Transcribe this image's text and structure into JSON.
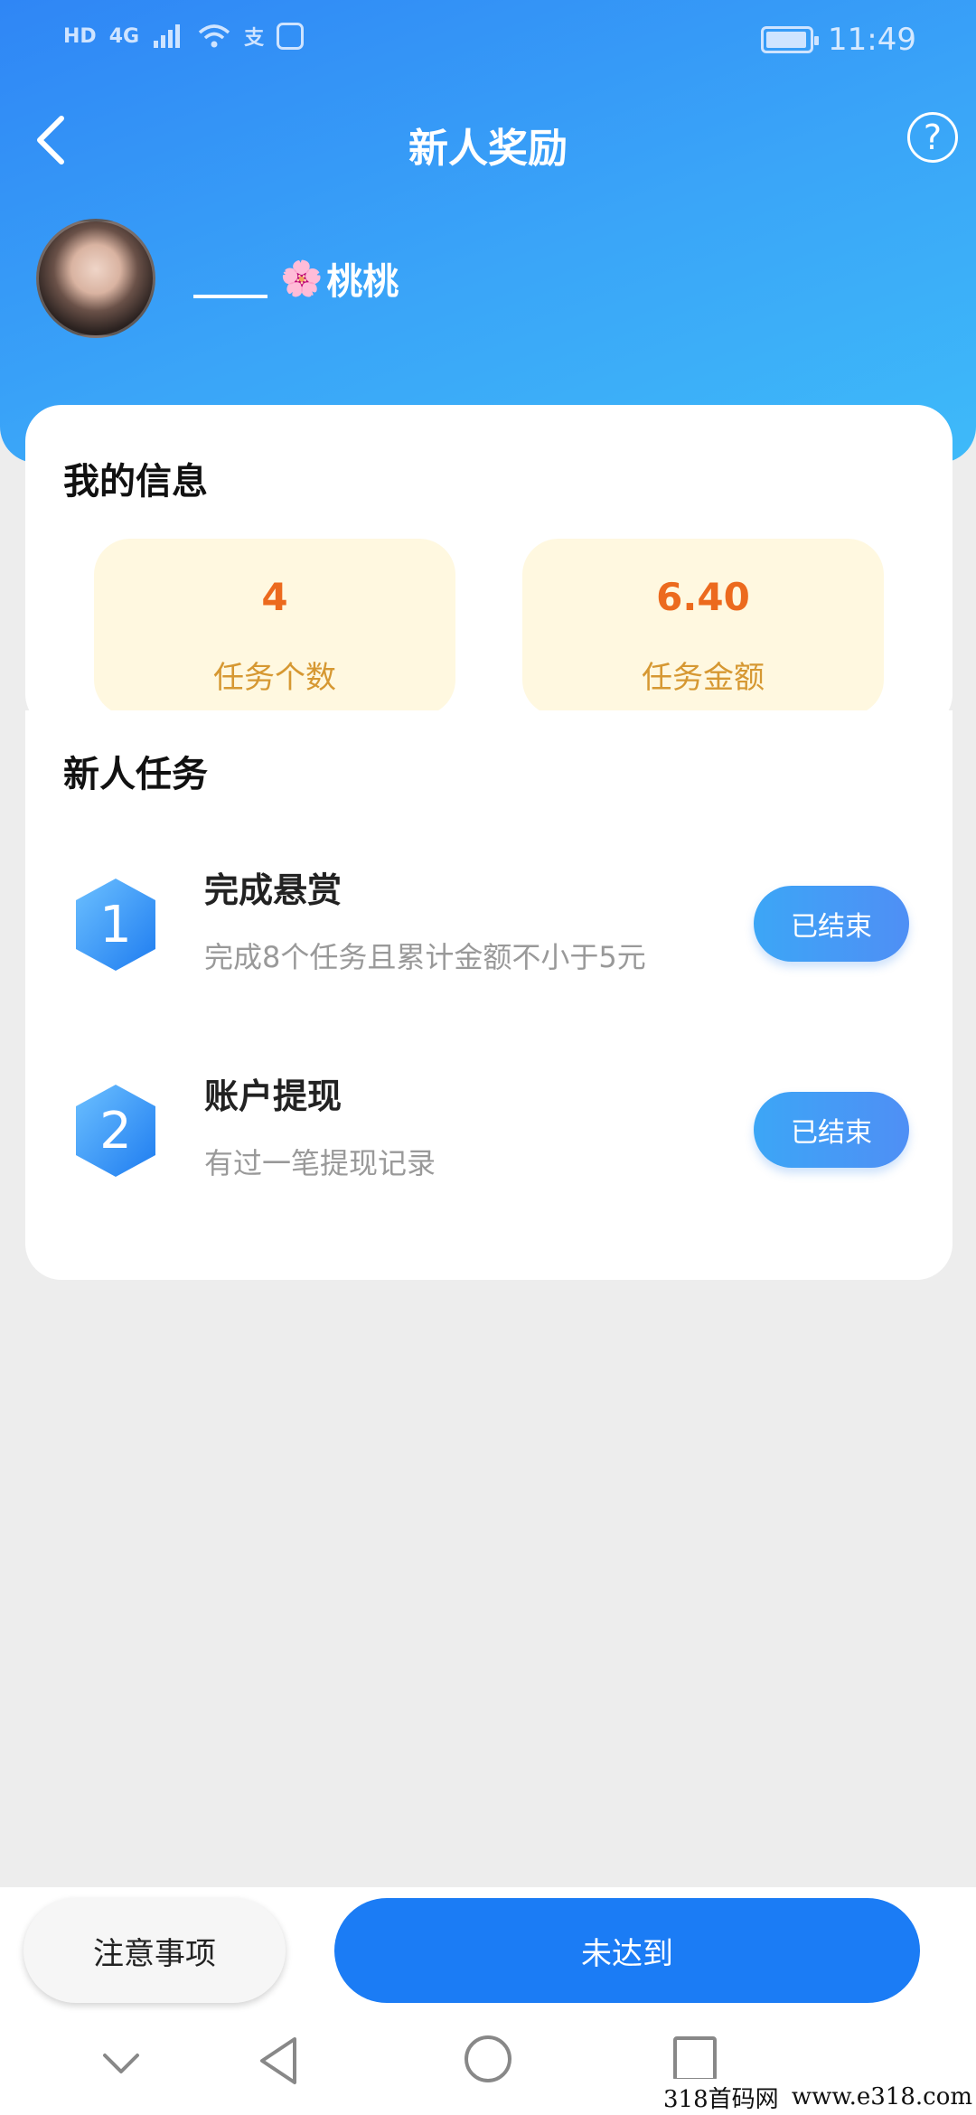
{
  "status_bar": {
    "network_chips": [
      "HD",
      "4G"
    ],
    "app_glyph": "支",
    "time": "11:49"
  },
  "nav": {
    "title": "新人奖励",
    "help_symbol": "?"
  },
  "profile": {
    "flower": "🌸",
    "nickname": "桃桃"
  },
  "info": {
    "title": "我的信息",
    "stats": [
      {
        "value": "4",
        "label": "任务个数"
      },
      {
        "value": "6.40",
        "label": "任务金额"
      }
    ]
  },
  "tasks": {
    "title": "新人任务",
    "items": [
      {
        "number": "1",
        "title": "完成悬赏",
        "desc": "完成8个任务且累计金额不小于5元",
        "button": "已结束"
      },
      {
        "number": "2",
        "title": "账户提现",
        "desc": "有过一笔提现记录",
        "button": "已结束"
      }
    ]
  },
  "bottom": {
    "notice_label": "注意事项",
    "main_label": "未达到"
  },
  "watermark": {
    "left": "318首码网",
    "right": "www.e318.com"
  },
  "colors": {
    "header_start": "#2f86f5",
    "header_end": "#3ebaf9",
    "stat_value": "#ec6a1e",
    "stat_label": "#d69832",
    "primary": "#1b7cf5"
  }
}
